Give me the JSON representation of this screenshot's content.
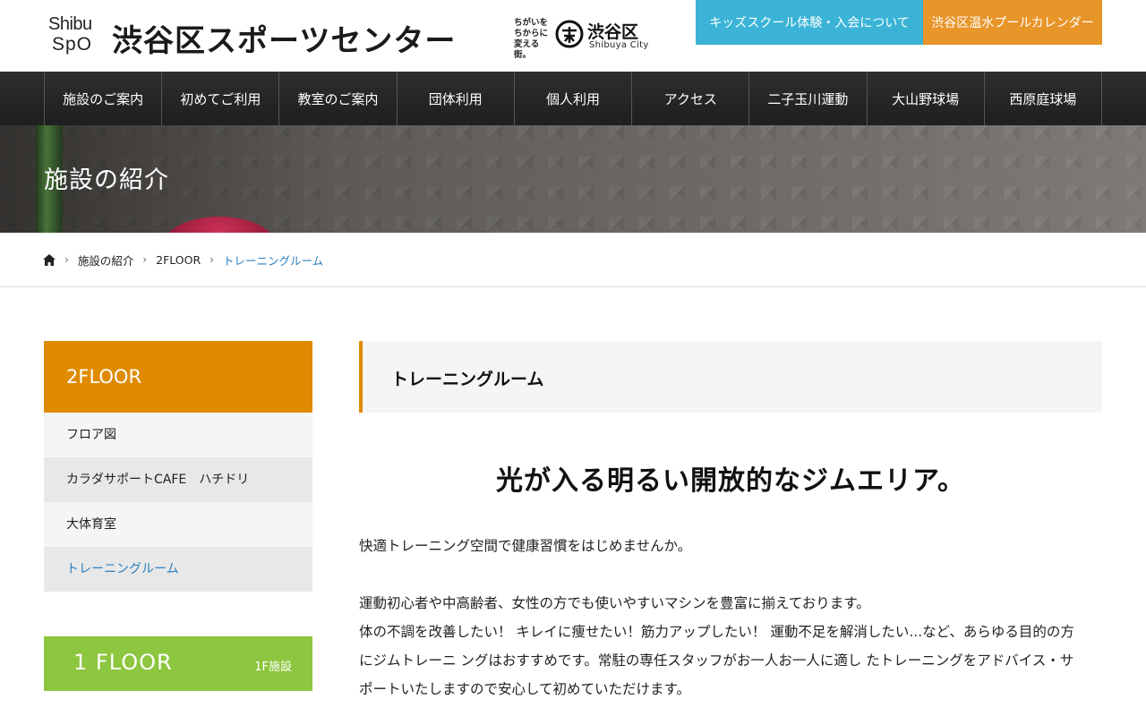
{
  "header": {
    "logo_line1": "Shibu",
    "logo_line2": "SpO",
    "site_title": "渋谷区スポーツセンター",
    "city_tagline": "ちがいを ちからに 変える街。",
    "city_name": "渋谷区",
    "city_name_en": "Shibuya City",
    "kids_button": "キッズスクール体験・入会について",
    "pool_button": "渋谷区温水プールカレンダー"
  },
  "nav": {
    "items": [
      {
        "label": "施設のご案内"
      },
      {
        "label": "初めてご利用"
      },
      {
        "label": "教室のご案内"
      },
      {
        "label": "団体利用"
      },
      {
        "label": "個人利用"
      },
      {
        "label": "アクセス"
      },
      {
        "label": "二子玉川運動"
      },
      {
        "label": "大山野球場"
      },
      {
        "label": "西原庭球場"
      }
    ]
  },
  "hero": {
    "title": "施設の紹介"
  },
  "breadcrumb": {
    "items": [
      "施設の紹介",
      "2FLOOR"
    ],
    "current": "トレーニングルーム"
  },
  "sidebar": {
    "heading": "2FLOOR",
    "items": [
      {
        "label": "フロア図"
      },
      {
        "label": "カラダサポートCAFE　ハチドリ"
      },
      {
        "label": "大体育室"
      },
      {
        "label": "トレーニングルーム"
      }
    ],
    "floor_banner": {
      "label": "1 FLOOR",
      "sub": "1F施設"
    }
  },
  "main": {
    "heading": "トレーニングルーム",
    "catch": "光が入る明るい開放的なジムエリア。",
    "paragraph1": "快適トレーニング空間で健康習慣をはじめませんか。",
    "paragraph2_line1": "運動初心者や中高齢者、女性の方でも使いやすいマシンを豊富に揃えております。",
    "paragraph2_line2": "体の不調を改善したい！ キレイに痩せたい！筋力アップしたい！ 運動不足を解消したい...など、あらゆる目的の方",
    "paragraph2_line3": "にジムトレーニ ングはおすすめです。常駐の専任スタッフがお一人お一人に適し たトレーニングをアドバイス・サ",
    "paragraph2_line4": "ポートいたしますので安心して初めていただけます。"
  },
  "colors": {
    "accent_orange": "#e08a00",
    "kids_blue": "#3ab3d6",
    "pool_orange": "#e8952a",
    "floor_green": "#8dc63f",
    "link_blue": "#2a7fc0"
  }
}
